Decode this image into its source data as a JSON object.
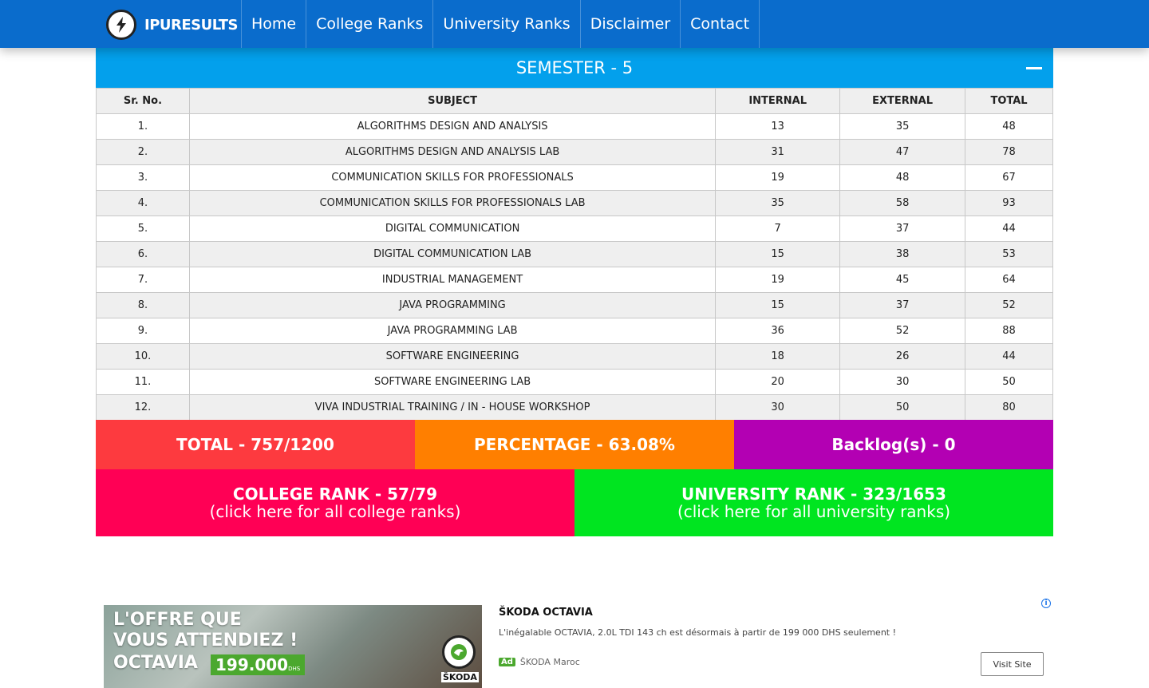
{
  "navbar": {
    "brand": "IPURESULTS",
    "items": [
      "Home",
      "College Ranks",
      "University Ranks",
      "Disclaimer",
      "Contact"
    ],
    "color": "#0a6ccc"
  },
  "semester": {
    "title": "SEMESTER - 5",
    "header_color": "#03a0ec"
  },
  "table": {
    "headers": [
      "Sr. No.",
      "SUBJECT",
      "INTERNAL",
      "EXTERNAL",
      "TOTAL"
    ],
    "rows": [
      [
        "1.",
        "ALGORITHMS DESIGN AND ANALYSIS",
        "13",
        "35",
        "48"
      ],
      [
        "2.",
        "ALGORITHMS DESIGN AND ANALYSIS LAB",
        "31",
        "47",
        "78"
      ],
      [
        "3.",
        "COMMUNICATION SKILLS FOR PROFESSIONALS",
        "19",
        "48",
        "67"
      ],
      [
        "4.",
        "COMMUNICATION SKILLS FOR PROFESSIONALS LAB",
        "35",
        "58",
        "93"
      ],
      [
        "5.",
        "DIGITAL COMMUNICATION",
        "7",
        "37",
        "44"
      ],
      [
        "6.",
        "DIGITAL COMMUNICATION LAB",
        "15",
        "38",
        "53"
      ],
      [
        "7.",
        "INDUSTRIAL MANAGEMENT",
        "19",
        "45",
        "64"
      ],
      [
        "8.",
        "JAVA PROGRAMMING",
        "15",
        "37",
        "52"
      ],
      [
        "9.",
        "JAVA PROGRAMMING LAB",
        "36",
        "52",
        "88"
      ],
      [
        "10.",
        "SOFTWARE ENGINEERING",
        "18",
        "26",
        "44"
      ],
      [
        "11.",
        "SOFTWARE ENGINEERING LAB",
        "20",
        "30",
        "50"
      ],
      [
        "12.",
        "VIVA INDUSTRIAL TRAINING / IN - HOUSE WORKSHOP",
        "30",
        "50",
        "80"
      ]
    ]
  },
  "summary": {
    "total": "TOTAL - 757/1200",
    "percentage": "PERCENTAGE - 63.08%",
    "backlogs": "Backlog(s) - 0",
    "colors": {
      "total": "#fd3a3f",
      "percentage": "#ff7f00",
      "backlogs": "#b300b3"
    }
  },
  "ranks": {
    "college": {
      "title": "COLLEGE RANK - 57/79",
      "link": "(click here for all college ranks)",
      "color": "#ff0055"
    },
    "university": {
      "title": "UNIVERSITY RANK - 323/1653",
      "link": "(click here for all university ranks)",
      "color": "#00e520"
    }
  },
  "ad": {
    "headline_line1": "L'OFFRE QUE",
    "headline_line2": "VOUS ATTENDIEZ !",
    "model": "OCTAVIA",
    "price": "199.000",
    "price_unit": "DHS",
    "brand_word": "ŠKODA",
    "title": "ŠKODA OCTAVIA",
    "description": "L'inégalable OCTAVIA, 2.0L TDI 143 ch est désormais à partir de 199 000 DHS seulement !",
    "tag": "Ad",
    "advertiser": "ŠKODA Maroc",
    "button": "Visit Site",
    "info": "i"
  }
}
